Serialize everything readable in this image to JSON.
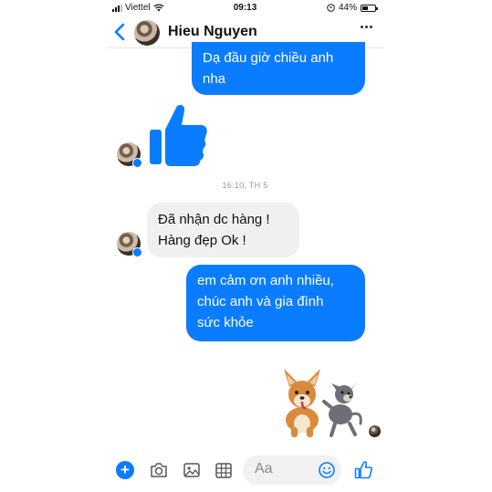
{
  "status_bar": {
    "carrier": "Viettel",
    "time": "09:13",
    "battery": "44%",
    "battery_fraction": 0.44
  },
  "header": {
    "contact_name": "Hieu Nguyen"
  },
  "messages": [
    {
      "side": "out",
      "text_lines": [
        "Dạ đầu giờ chiều anh",
        "nha"
      ]
    },
    {
      "side": "in",
      "kind": "like-sticker"
    },
    {
      "kind": "timestamp",
      "text": "16:10, TH 5"
    },
    {
      "side": "in",
      "text_lines": [
        "Đã nhận dc hàng !",
        "Hàng đẹp Ok !"
      ]
    },
    {
      "side": "out",
      "text_lines": [
        "em cảm ơn anh nhiều,",
        "chúc anh và gia đình",
        "sức khỏe"
      ]
    },
    {
      "side": "out",
      "kind": "dog-sticker"
    }
  ],
  "composer": {
    "placeholder": "Aa"
  },
  "colors": {
    "accent": "#0a7cff",
    "incoming_bubble": "#f0f0f0"
  },
  "icons": [
    "back-chevron-icon",
    "more-dots-icon",
    "messenger-badge-icon",
    "thumbs-up-icon",
    "plus-icon",
    "camera-icon",
    "photo-icon",
    "sticker-grid-icon",
    "emoji-icon",
    "like-icon",
    "wifi-icon",
    "location-arrow-icon",
    "battery-icon",
    "signal-icon"
  ]
}
